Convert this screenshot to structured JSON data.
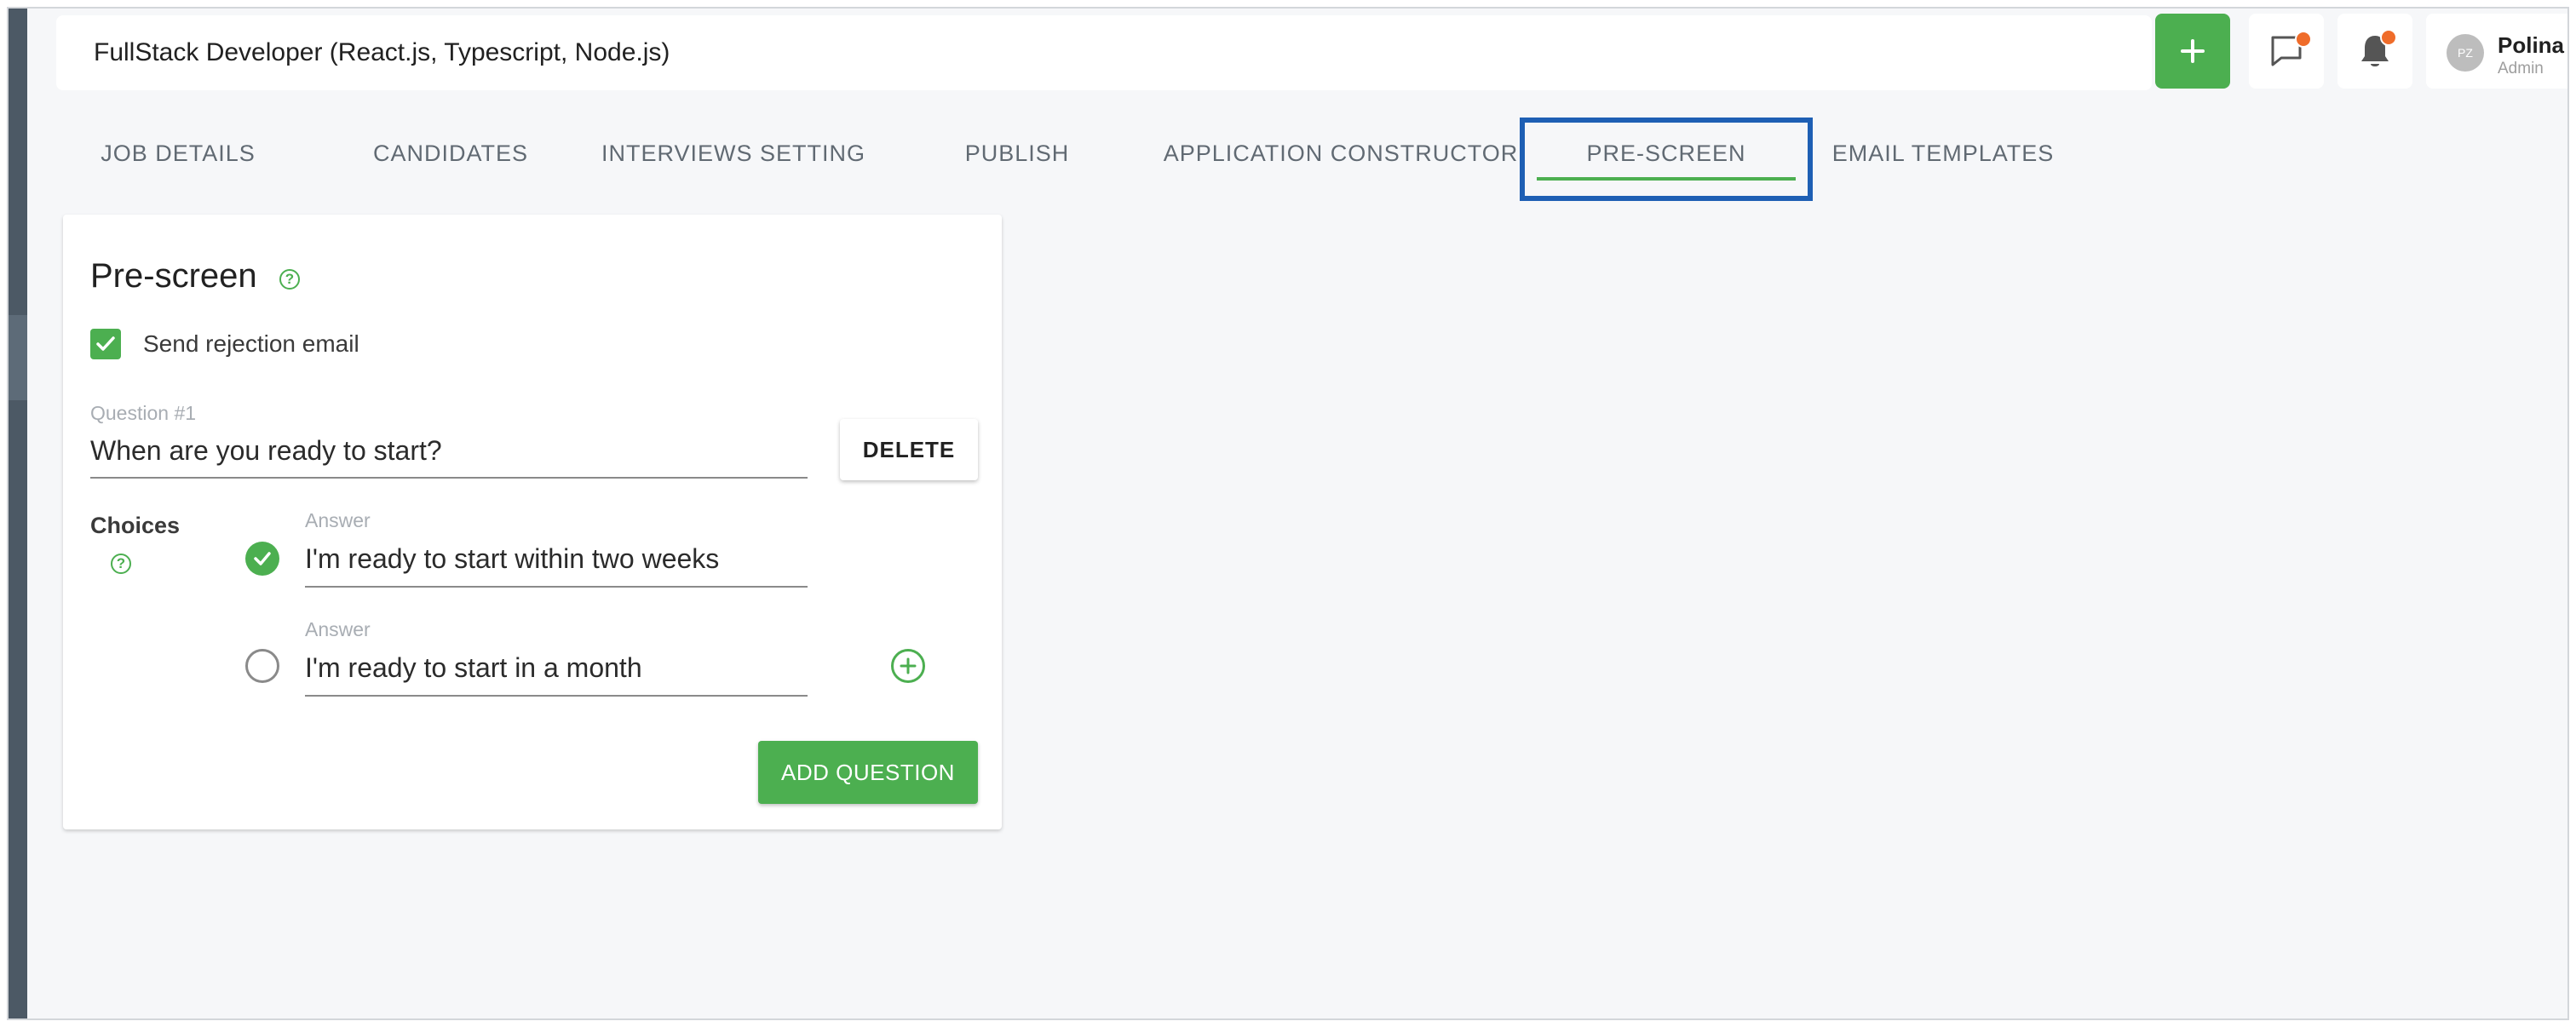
{
  "header": {
    "job_title": "FullStack Developer (React.js, Typescript, Node.js)",
    "user": {
      "initials": "PZ",
      "name": "Polina Z",
      "role": "Admin"
    }
  },
  "tabs": [
    {
      "label": "JOB DETAILS"
    },
    {
      "label": "CANDIDATES"
    },
    {
      "label": "INTERVIEWS SETTING"
    },
    {
      "label": "PUBLISH"
    },
    {
      "label": "APPLICATION CONSTRUCTOR"
    },
    {
      "label": "PRE-SCREEN",
      "active": true
    },
    {
      "label": "EMAIL TEMPLATES"
    }
  ],
  "prescreen": {
    "title": "Pre-screen",
    "send_rejection_label": "Send rejection email",
    "send_rejection_checked": true,
    "question": {
      "label": "Question #1",
      "value": "When are you ready to start?"
    },
    "delete_label": "DELETE",
    "choices_label": "Choices",
    "answers": [
      {
        "label": "Answer",
        "value": "I'm ready to start within two weeks",
        "correct": true
      },
      {
        "label": "Answer",
        "value": "I'm ready to start in a month",
        "correct": false
      }
    ],
    "add_question_label": "ADD QUESTION"
  },
  "colors": {
    "accent_green": "#4caf50",
    "highlight_blue": "#1e5fb4",
    "notification_dot": "#ef6c2a"
  },
  "icons": {
    "add": "plus-icon",
    "chat": "chat-icon",
    "notifications": "bell-icon",
    "help": "help-circle-icon",
    "add_choice": "plus-circle-icon"
  }
}
